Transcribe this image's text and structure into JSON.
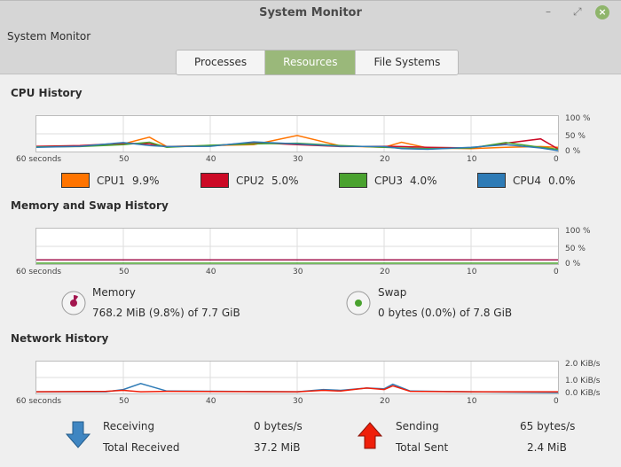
{
  "window": {
    "title": "System Monitor",
    "app_title": "System Monitor"
  },
  "tabs": [
    {
      "label": "Processes"
    },
    {
      "label": "Resources",
      "active": true
    },
    {
      "label": "File Systems"
    }
  ],
  "cpu": {
    "heading": "CPU History",
    "y_ticks": [
      "100 %",
      "50 %",
      "0 %"
    ],
    "legend": [
      {
        "name": "CPU1",
        "value": "9.9%",
        "color": "#ff7400"
      },
      {
        "name": "CPU2",
        "value": "5.0%",
        "color": "#cc0a26"
      },
      {
        "name": "CPU3",
        "value": "4.0%",
        "color": "#4aa22f"
      },
      {
        "name": "CPU4",
        "value": "0.0%",
        "color": "#2e7bb6"
      }
    ]
  },
  "x_ticks": [
    "60 seconds",
    "50",
    "40",
    "30",
    "20",
    "10",
    "0"
  ],
  "memory": {
    "heading": "Memory and Swap History",
    "y_ticks": [
      "100 %",
      "50 %",
      "0 %"
    ],
    "memory_label": "Memory",
    "memory_value": "768.2 MiB (9.8%) of 7.7 GiB",
    "memory_color": "#a3164f",
    "memory_fraction": 0.098,
    "swap_label": "Swap",
    "swap_value": "0 bytes (0.0%) of 7.8 GiB",
    "swap_color": "#4aa22f",
    "swap_fraction": 0.0
  },
  "network": {
    "heading": "Network History",
    "y_ticks": [
      "2.0 KiB/s",
      "1.0 KiB/s",
      "0.0 KiB/s"
    ],
    "receiving_label": "Receiving",
    "receiving_value": "0 bytes/s",
    "total_received_label": "Total Received",
    "total_received_value": "37.2 MiB",
    "sending_label": "Sending",
    "sending_value": "65 bytes/s",
    "total_sent_label": "Total Sent",
    "total_sent_value": "2.4 MiB",
    "receiving_color": "#2e7bb6",
    "sending_color": "#ef1f0a"
  },
  "chart_data": [
    {
      "type": "line",
      "x": [
        60,
        55,
        50,
        47,
        45,
        40,
        35,
        30,
        25,
        20,
        18,
        15,
        10,
        6,
        2,
        0
      ],
      "ylim": [
        0,
        100
      ],
      "series": [
        {
          "name": "CPU1",
          "values": [
            12,
            14,
            20,
            40,
            12,
            15,
            18,
            45,
            14,
            10,
            25,
            8,
            6,
            10,
            12,
            10
          ]
        },
        {
          "name": "CPU2",
          "values": [
            13,
            15,
            22,
            20,
            12,
            14,
            24,
            18,
            12,
            13,
            12,
            10,
            8,
            22,
            35,
            5
          ]
        },
        {
          "name": "CPU3",
          "values": [
            11,
            12,
            18,
            25,
            10,
            16,
            20,
            22,
            15,
            10,
            8,
            6,
            8,
            24,
            10,
            4
          ]
        },
        {
          "name": "CPU4",
          "values": [
            10,
            13,
            24,
            15,
            12,
            13,
            26,
            20,
            13,
            12,
            6,
            4,
            10,
            18,
            8,
            0
          ]
        }
      ]
    },
    {
      "type": "line",
      "x": [
        60,
        0
      ],
      "ylim": [
        0,
        100
      ],
      "series": [
        {
          "name": "Memory",
          "values": [
            9.8,
            9.8
          ]
        },
        {
          "name": "Swap",
          "values": [
            0,
            0
          ]
        }
      ]
    },
    {
      "type": "line",
      "x": [
        60,
        52,
        50,
        48,
        45,
        30,
        27,
        25,
        22,
        20,
        19,
        17,
        10,
        0
      ],
      "ylim": [
        0,
        2
      ],
      "series": [
        {
          "name": "Receiving",
          "values": [
            0.05,
            0.05,
            0.2,
            0.6,
            0.1,
            0.05,
            0.2,
            0.15,
            0.3,
            0.25,
            0.55,
            0.1,
            0.05,
            0
          ]
        },
        {
          "name": "Sending",
          "values": [
            0.05,
            0.08,
            0.15,
            0.05,
            0.08,
            0.05,
            0.15,
            0.1,
            0.3,
            0.2,
            0.45,
            0.08,
            0.05,
            0.05
          ]
        }
      ]
    }
  ]
}
